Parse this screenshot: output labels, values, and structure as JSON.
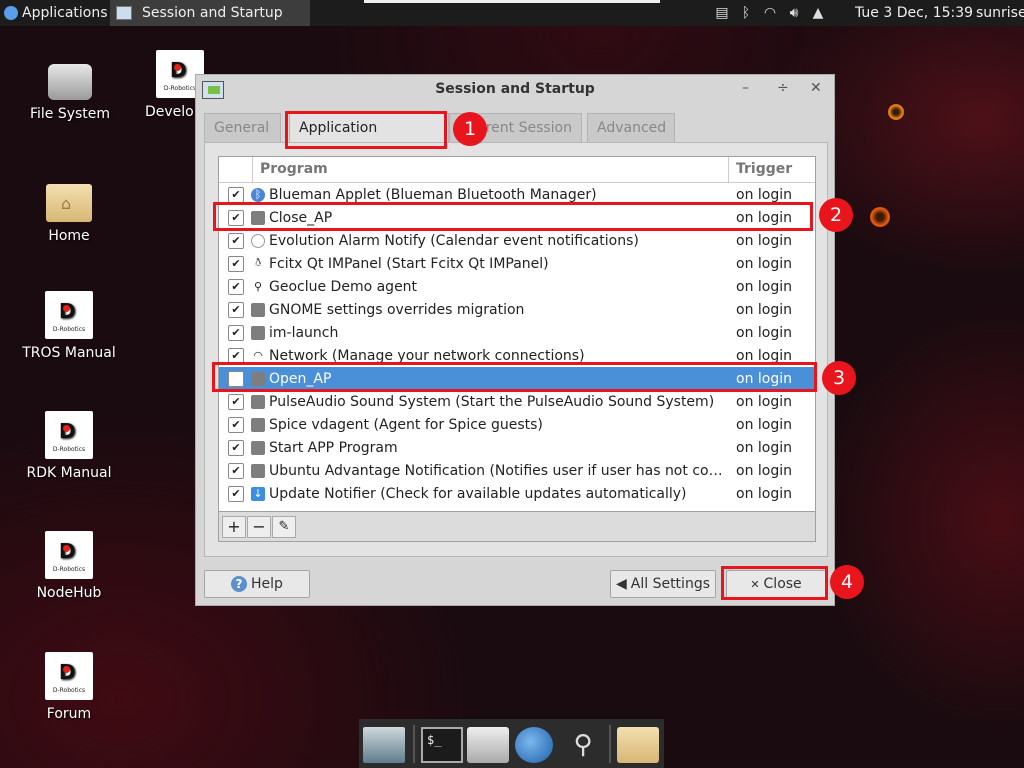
{
  "top_panel": {
    "applications_label": "Applications",
    "task_title": "Session and Startup",
    "clock": "Tue  3 Dec, 15:39",
    "user": "sunrise"
  },
  "desktop_icons": [
    {
      "label": "File System",
      "icon": "drive-icon"
    },
    {
      "label": "Developer",
      "icon": "d-robotics-logo"
    },
    {
      "label": "Home",
      "icon": "home-folder-icon"
    },
    {
      "label": "TROS Manual",
      "icon": "d-robotics-logo"
    },
    {
      "label": "RDK Manual",
      "icon": "d-robotics-logo"
    },
    {
      "label": "NodeHub",
      "icon": "d-robotics-logo"
    },
    {
      "label": "Forum",
      "icon": "d-robotics-logo"
    }
  ],
  "logo_text": "D-Robotics",
  "dialog": {
    "title": "Session and Startup",
    "tabs": [
      "General",
      "Application Autostart",
      "Current Session",
      "Advanced"
    ],
    "active_tab": "Application Autostart",
    "columns": {
      "program": "Program",
      "trigger": "Trigger"
    },
    "rows": [
      {
        "checked": true,
        "program": "Blueman Applet (Blueman Bluetooth Manager)",
        "trigger": "on login",
        "icon": "bluetooth-icon"
      },
      {
        "checked": true,
        "program": "Close_AP",
        "trigger": "on login",
        "icon": "gear-icon"
      },
      {
        "checked": true,
        "program": "Evolution Alarm Notify (Calendar event notifications)",
        "trigger": "on login",
        "icon": "clock-icon"
      },
      {
        "checked": true,
        "program": "Fcitx Qt IMPanel (Start Fcitx Qt IMPanel)",
        "trigger": "on login",
        "icon": "penguin-icon"
      },
      {
        "checked": true,
        "program": "Geoclue Demo agent",
        "trigger": "on login",
        "icon": "location-pin-icon"
      },
      {
        "checked": true,
        "program": "GNOME settings overrides migration",
        "trigger": "on login",
        "icon": "gear-icon"
      },
      {
        "checked": true,
        "program": "im-launch",
        "trigger": "on login",
        "icon": "gear-icon"
      },
      {
        "checked": true,
        "program": "Network (Manage your network connections)",
        "trigger": "on login",
        "icon": "wifi-icon"
      },
      {
        "checked": false,
        "program": "Open_AP",
        "trigger": "on login",
        "icon": "gear-icon",
        "selected": true
      },
      {
        "checked": true,
        "program": "PulseAudio Sound System (Start the PulseAudio Sound System)",
        "trigger": "on login",
        "icon": "gear-icon"
      },
      {
        "checked": true,
        "program": "Spice vdagent (Agent for Spice guests)",
        "trigger": "on login",
        "icon": "gear-icon"
      },
      {
        "checked": true,
        "program": "Start APP Program",
        "trigger": "on login",
        "icon": "gear-icon"
      },
      {
        "checked": true,
        "program": "Ubuntu Advantage Notification (Notifies user if user has not connected to Ubuntu Advantage)",
        "trigger": "on login",
        "icon": "gear-icon"
      },
      {
        "checked": true,
        "program": "Update Notifier (Check for available updates automatically)",
        "trigger": "on login",
        "icon": "download-icon"
      }
    ],
    "buttons": {
      "help": "Help",
      "all_settings": "All Settings",
      "close": "Close"
    }
  },
  "annotations": [
    "1",
    "2",
    "3",
    "4"
  ],
  "colors": {
    "highlight": "#e8151c",
    "selection": "#4a90d9"
  }
}
